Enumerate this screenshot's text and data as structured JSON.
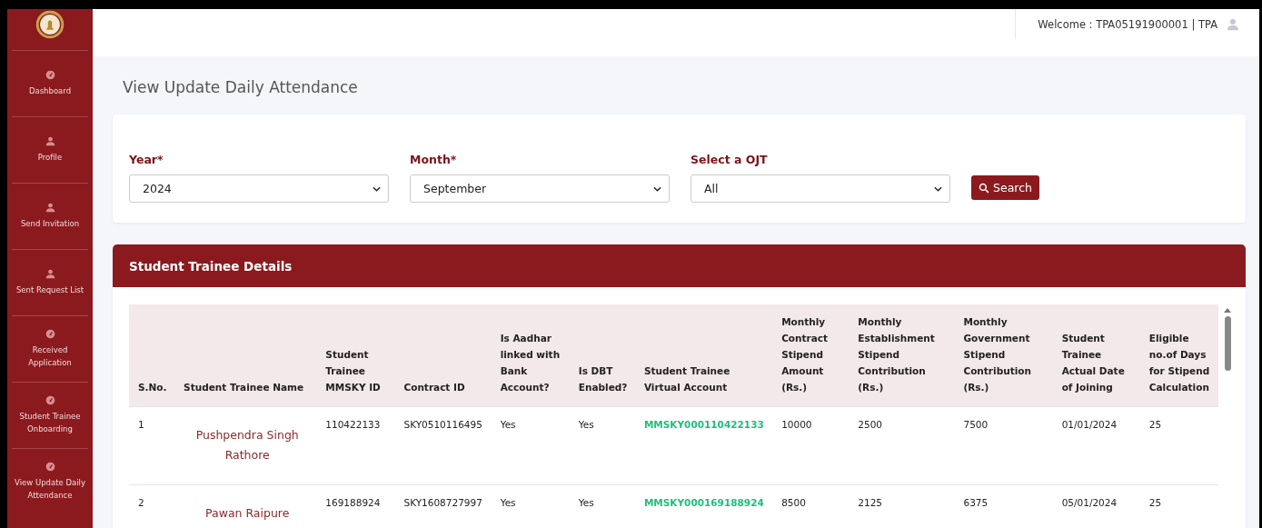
{
  "sidebar": {
    "items": [
      {
        "label": "Dashboard",
        "kind": "gauge"
      },
      {
        "label": "Profile",
        "kind": "person"
      },
      {
        "label": "Send Invitation",
        "kind": "person"
      },
      {
        "label": "Sent Request List",
        "kind": "person"
      },
      {
        "label": "Received Application",
        "kind": "gauge"
      },
      {
        "label": "Student Trainee Onboarding",
        "kind": "gauge"
      },
      {
        "label": "View Update Daily Attendance",
        "kind": "gauge"
      }
    ]
  },
  "header": {
    "welcome": "Welcome : TPA05191900001 | TPA"
  },
  "page_title": "View Update Daily Attendance",
  "filters": {
    "fields": [
      {
        "label": "Year*",
        "value": "2024"
      },
      {
        "label": "Month*",
        "value": "September"
      },
      {
        "label": "Select a OJT",
        "value": "All"
      }
    ],
    "search_button": "Search"
  },
  "table": {
    "title": "Student Trainee Details",
    "columns": [
      "S.No.",
      "Student Trainee Name",
      "Student Trainee MMSKY ID",
      "Contract ID",
      "Is Aadhar linked with Bank Account?",
      "Is DBT Enabled?",
      "Student Trainee Virtual Account",
      "Monthly Contract Stipend Amount (Rs.)",
      "Monthly Establishment Stipend Contribution (Rs.)",
      "Monthly Government Stipend Contribution (Rs.)",
      "Student Trainee Actual Date of Joining",
      "Eligible no.of Days for Stipend Calculation"
    ],
    "rows": [
      [
        "1",
        "Pushpendra Singh Rathore",
        "110422133",
        "SKY0510116495",
        "Yes",
        "Yes",
        "MMSKY000110422133",
        "10000",
        "2500",
        "7500",
        "01/01/2024",
        "25"
      ],
      [
        "2",
        "Pawan Raipure",
        "169188924",
        "SKY1608727997",
        "Yes",
        "Yes",
        "MMSKY000169188924",
        "8500",
        "2125",
        "6375",
        "05/01/2024",
        "25"
      ]
    ]
  }
}
